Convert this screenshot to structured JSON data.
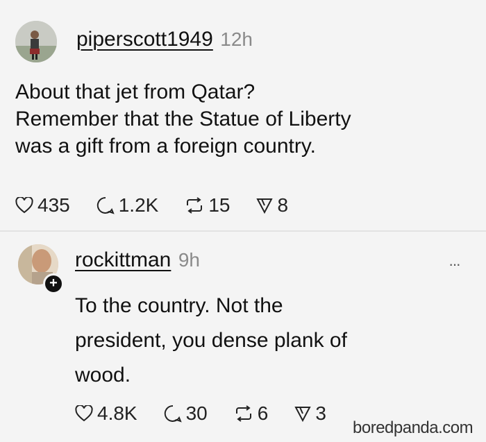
{
  "posts": [
    {
      "username": "piperscott1949",
      "time": "12h",
      "text_lines": [
        "About that jet from Qatar?",
        "Remember that the Statue of Liberty",
        "was a gift from a foreign country."
      ],
      "likes": "435",
      "replies": "1.2K",
      "reposts": "15",
      "shares": "8"
    },
    {
      "username": "rockittman",
      "time": "9h",
      "text_lines": [
        "To the country. Not the",
        "president, you dense plank of",
        "wood."
      ],
      "likes": "4.8K",
      "replies": "30",
      "reposts": "6",
      "shares": "3",
      "more_label": "···"
    }
  ],
  "watermark": "boredpanda.com",
  "icons": [
    "heart-icon",
    "comment-icon",
    "repost-icon",
    "share-icon",
    "plus-icon"
  ]
}
